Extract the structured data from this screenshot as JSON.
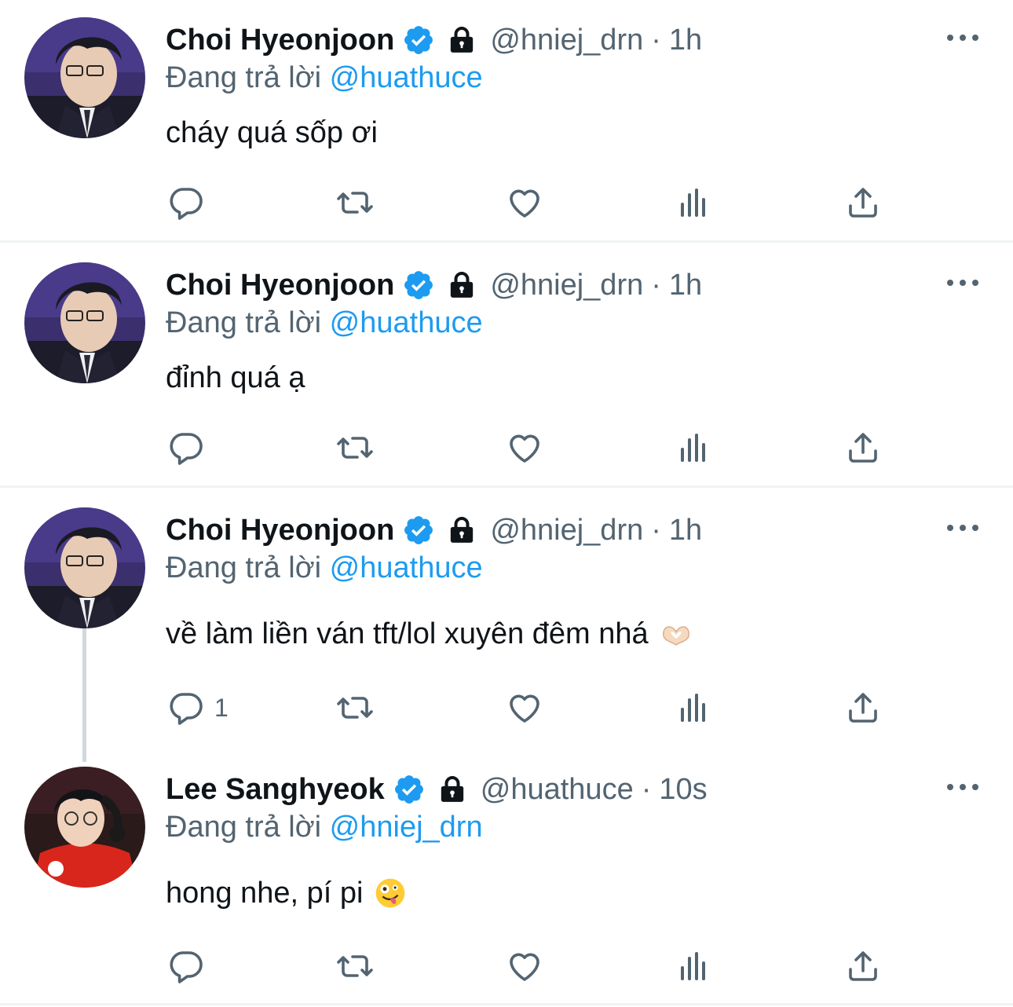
{
  "colors": {
    "accent": "#1d9bf0",
    "text": "#0f1419",
    "muted": "#536471",
    "divider": "#eff3f4"
  },
  "replying_prefix": "Đang trả lời",
  "tweets": [
    {
      "name": "Choi Hyeonjoon",
      "handle": "@hniej_drn",
      "separator": "·",
      "time": "1h",
      "replying_to": "@huathuce",
      "text": "cháy quá sốp ơi",
      "reply_count": "",
      "icons": [
        "verified-badge-icon",
        "lock-icon",
        "more-icon",
        "reply-icon",
        "retweet-icon",
        "like-icon",
        "views-icon",
        "share-icon"
      ]
    },
    {
      "name": "Choi Hyeonjoon",
      "handle": "@hniej_drn",
      "separator": "·",
      "time": "1h",
      "replying_to": "@huathuce",
      "text": "đỉnh quá ạ",
      "reply_count": ""
    },
    {
      "name": "Choi Hyeonjoon",
      "handle": "@hniej_drn",
      "separator": "·",
      "time": "1h",
      "replying_to": "@huathuce",
      "text": "về làm liền ván tft/lol xuyên đêm nhá",
      "emoji": "heart-hands-emoji",
      "reply_count": "1"
    },
    {
      "name": "Lee Sanghyeok",
      "handle": "@huathuce",
      "separator": "·",
      "time": "10s",
      "replying_to": "@hniej_drn",
      "text": "hong nhe, pí pi",
      "emoji": "zany-face-emoji",
      "reply_count": ""
    }
  ]
}
